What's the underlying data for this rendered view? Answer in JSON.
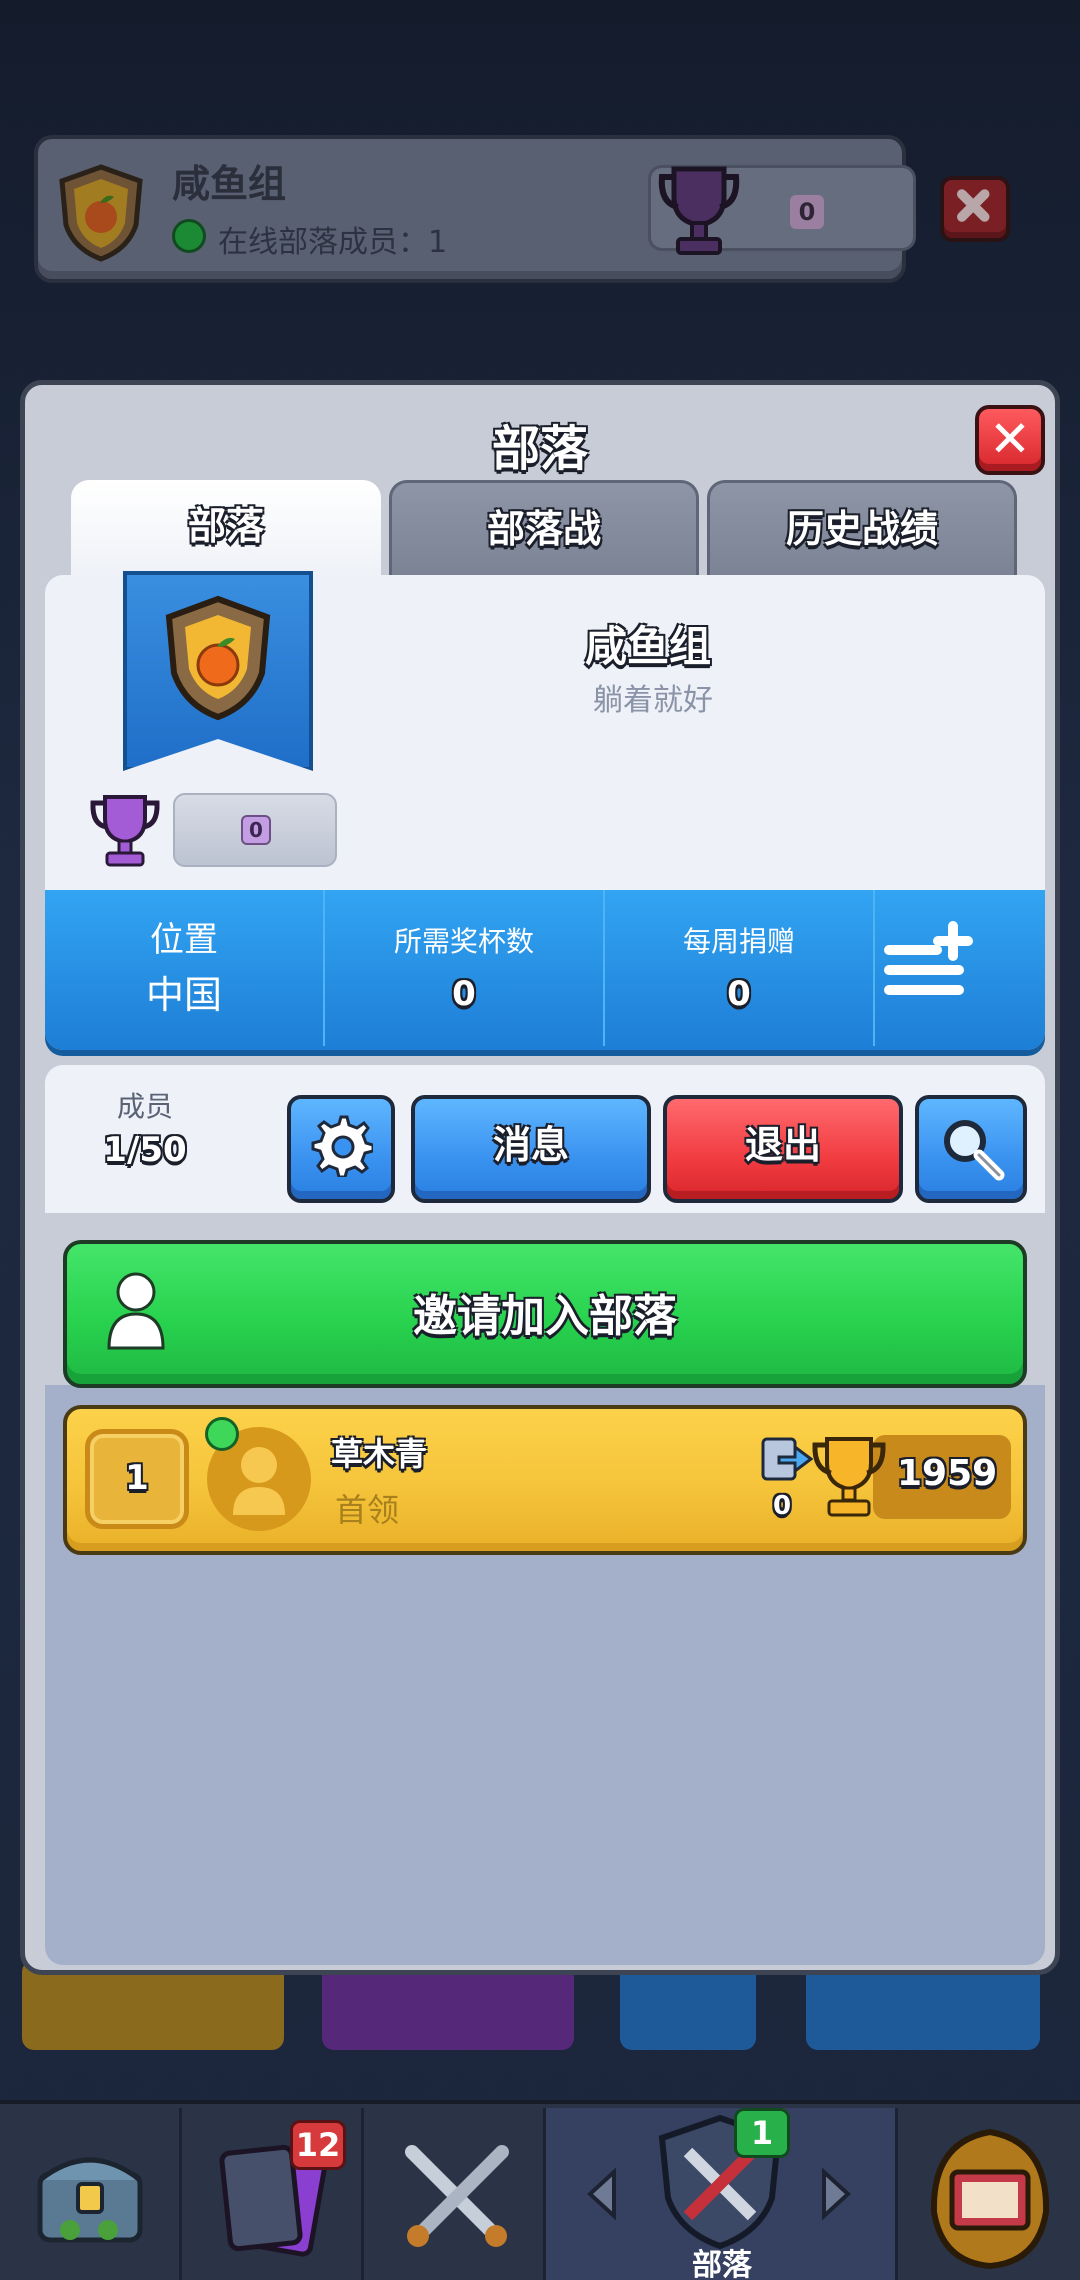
{
  "top_card": {
    "clan_name": "咸鱼组",
    "online_text": "在线部落成员：1",
    "trophies": "0"
  },
  "modal": {
    "title": "部落",
    "tabs": [
      "部落",
      "部落战",
      "历史战绩"
    ]
  },
  "clan": {
    "name": "咸鱼组",
    "description": "躺着就好",
    "score": "0",
    "location_label": "位置",
    "location_value": "中国",
    "required_trophies_label": "所需奖杯数",
    "required_trophies_value": "0",
    "weekly_donations_label": "每周捐赠",
    "weekly_donations_value": "0"
  },
  "members": {
    "label": "成员",
    "count": "1/50",
    "message_button": "消息",
    "leave_button": "退出",
    "invite_button": "邀请加入部落",
    "list": [
      {
        "rank": "1",
        "name": "草木青",
        "role": "首领",
        "donations": "0",
        "trophies": "1959"
      }
    ]
  },
  "nav": {
    "cards_badge": "12",
    "clan_badge": "1",
    "clan_label": "部落"
  },
  "icons": [
    "clan-shield-icon",
    "trophy-icon",
    "close-icon",
    "gear-icon",
    "search-icon",
    "menu-plus-icon",
    "person-icon",
    "donation-icon",
    "chest-icon",
    "cards-icon",
    "battle-swords-icon",
    "arrow-left-icon",
    "arrow-right-icon",
    "tournament-icon"
  ],
  "colors": {
    "green_button": "#28d24e",
    "red_button": "#f13c41",
    "blue_button": "#3a92f0",
    "gold_row": "#f5c43a",
    "stats_blue": "#1e7ed6"
  }
}
